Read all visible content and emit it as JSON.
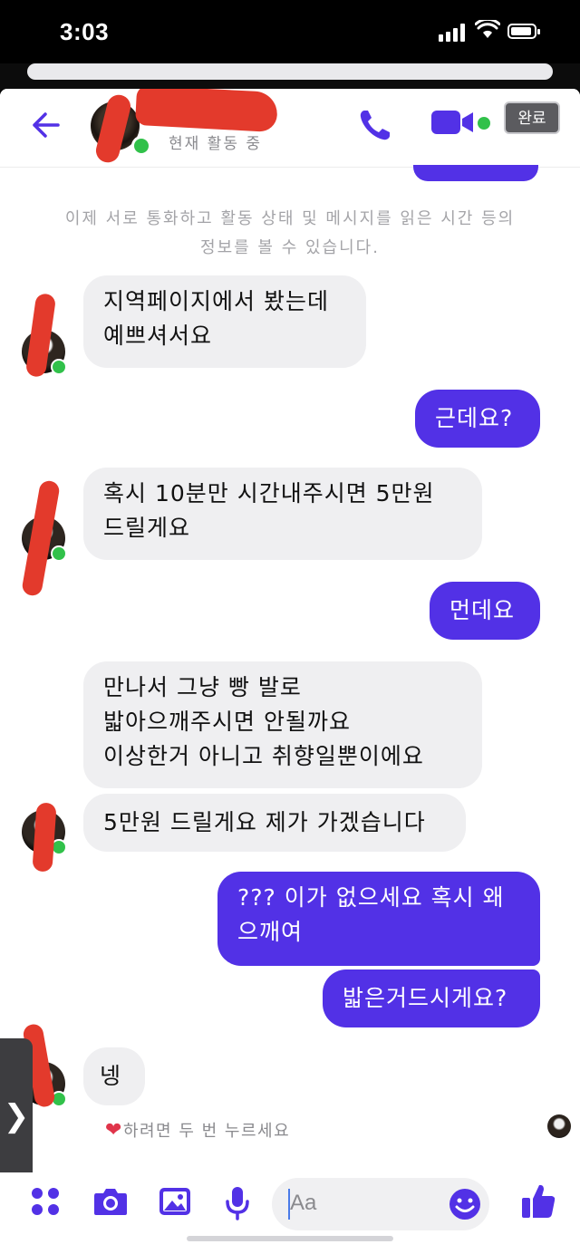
{
  "status_bar": {
    "time": "3:03"
  },
  "header": {
    "active_status": "현재 활동 중",
    "done_label": "완료"
  },
  "system_message": "이제 서로 통화하고 활동 상태 및 메시지를 읽은 시간 등의 정보를 볼 수 있습니다.",
  "messages": [
    {
      "side": "in",
      "text": "지역페이지에서 봤는데\n예쁘셔서요"
    },
    {
      "side": "out",
      "text": "근데요?"
    },
    {
      "side": "in",
      "text": "혹시 10분만 시간내주시면 5만원\n드릴게요"
    },
    {
      "side": "out",
      "text": "먼데요"
    },
    {
      "side": "in",
      "text": "만나서 그냥 빵 발로\n밟아으깨주시면 안될까요\n이상한거 아니고 취향일뿐이에요"
    },
    {
      "side": "in",
      "text": "5만원 드릴게요 제가 가겠습니다"
    },
    {
      "side": "out",
      "text": "??? 이가 없으세요 혹시 왜\n으깨여"
    },
    {
      "side": "out",
      "text": "밟은거드시게요?"
    },
    {
      "side": "in",
      "text": "넹"
    }
  ],
  "reaction_hint": {
    "heart": "❤",
    "text": "하려면 두 번 누르세요"
  },
  "side_tab_glyph": "❯",
  "composer": {
    "placeholder": "Aa"
  },
  "colors": {
    "accent": "#5231e6",
    "incoming": "#efeff1",
    "online": "#31c14a",
    "redaction": "#e33a2c"
  },
  "icons": [
    "back-arrow-icon",
    "phone-icon",
    "video-camera-icon",
    "apps-grid-icon",
    "camera-icon",
    "gallery-icon",
    "microphone-icon",
    "emoji-icon",
    "thumbs-up-icon"
  ]
}
